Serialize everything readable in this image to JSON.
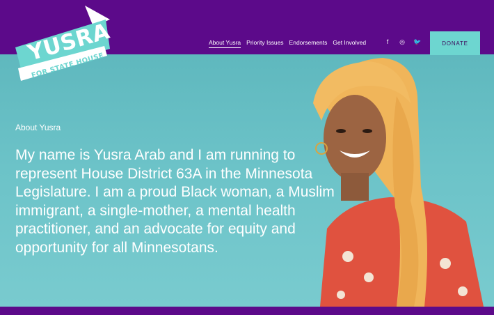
{
  "logo": {
    "name": "YUSRA",
    "tagline": "FOR STATE HOUSE"
  },
  "nav": {
    "items": [
      {
        "label": "About Yusra",
        "active": true
      },
      {
        "label": "Priority Issues"
      },
      {
        "label": "Endorsements"
      },
      {
        "label": "Get Involved"
      }
    ],
    "social": [
      "facebook-icon",
      "instagram-icon",
      "twitter-icon"
    ],
    "social_glyphs": [
      "f",
      "◎",
      "🐦"
    ],
    "donate_label": "DONATE"
  },
  "hero": {
    "eyebrow": "About Yusra",
    "lead": "My name is Yusra Arab and I am running to represent House District 63A in the Minnesota Legislature. I am a proud Black woman, a Muslim immigrant, a single-mother, a mental health practitioner, and an advocate for equity and opportunity for all Minnesotans."
  },
  "colors": {
    "brand_purple": "#5c0a8a",
    "teal": "#6dd6d0",
    "hero_bg": "#6cc3c8",
    "scarf": "#f0b55a",
    "blouse": "#e0523f"
  }
}
